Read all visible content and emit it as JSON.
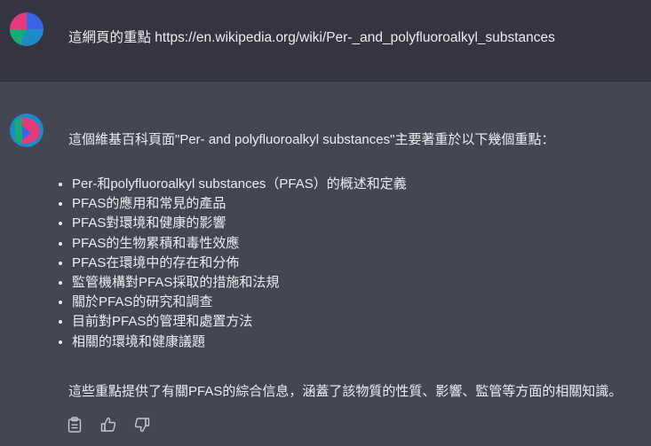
{
  "user_message": {
    "avatar_icon": "user-avatar-icon",
    "text": "這網頁的重點 https://en.wikipedia.org/wiki/Per-_and_polyfluoroalkyl_substances"
  },
  "assistant_message": {
    "avatar_icon": "assistant-avatar-icon",
    "intro": "這個維基百科頁面\"Per- and polyfluoroalkyl substances\"主要著重於以下幾個重點：",
    "points": [
      "Per-和polyfluoroalkyl substances（PFAS）的概述和定義",
      "PFAS的應用和常見的產品",
      "PFAS對環境和健康的影響",
      "PFAS的生物累積和毒性效應",
      "PFAS在環境中的存在和分佈",
      "監管機構對PFAS採取的措施和法規",
      "關於PFAS的研究和調查",
      "目前對PFAS的管理和處置方法",
      "相關的環境和健康議題"
    ],
    "summary": "這些重點提供了有關PFAS的綜合信息，涵蓋了該物質的性質、影響、監管等方面的相關知識。"
  },
  "actions": {
    "copy_icon": "clipboard-icon",
    "like_icon": "thumbs-up-icon",
    "dislike_icon": "thumbs-down-icon"
  },
  "colors": {
    "user_bg": "#343541",
    "assistant_bg": "#444654",
    "text": "#ececf1"
  }
}
